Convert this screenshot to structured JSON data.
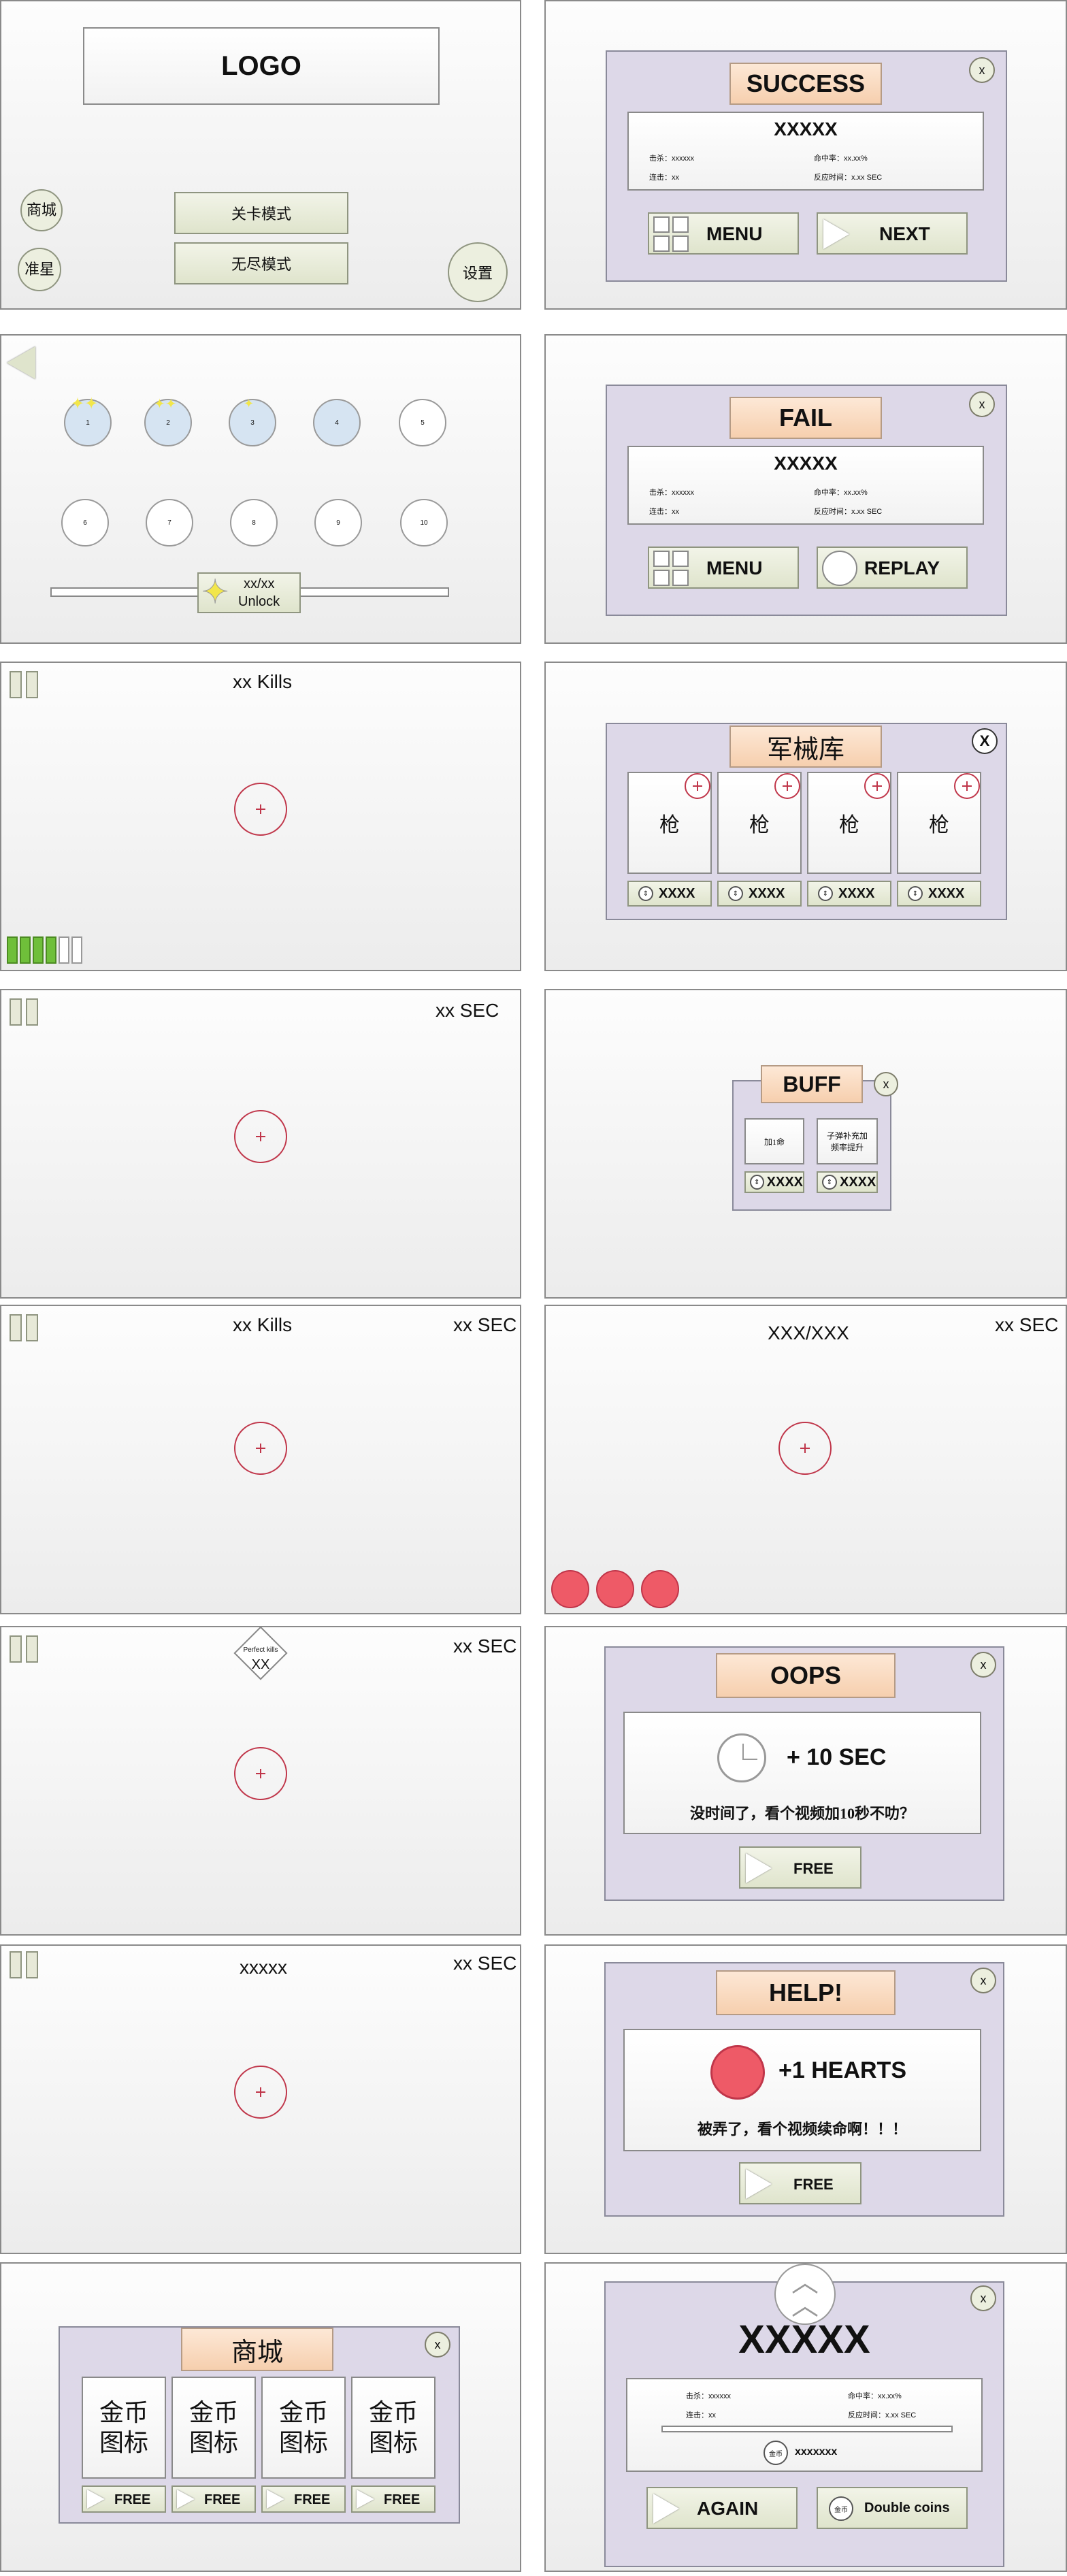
{
  "home": {
    "logo": "LOGO",
    "shop": "商城",
    "crosshair": "准星",
    "level_mode": "关卡模式",
    "endless_mode": "无尽模式",
    "settings": "设置"
  },
  "success": {
    "title": "SUCCESS",
    "name": "XXXXX",
    "kills": "击杀：xxxxxx",
    "hit_rate": "命中率：xx.xx%",
    "streak": "连击：xx",
    "reaction": "反应时间：x.xx SEC",
    "menu": "MENU",
    "next": "NEXT",
    "close": "x"
  },
  "levels": {
    "nodes": [
      "1",
      "2",
      "3",
      "4",
      "5",
      "6",
      "7",
      "8",
      "9",
      "10"
    ],
    "progress": "xx/xx",
    "unlock": "Unlock"
  },
  "fail": {
    "title": "FAIL",
    "name": "XXXXX",
    "kills": "击杀：xxxxxx",
    "hit_rate": "命中率：xx.xx%",
    "streak": "连击：xx",
    "reaction": "反应时间：x.xx SEC",
    "menu": "MENU",
    "replay": "REPLAY",
    "close": "x"
  },
  "game_kills": {
    "kills": "xx Kills"
  },
  "armory": {
    "title": "军械库",
    "items": [
      "枪",
      "枪",
      "枪",
      "枪"
    ],
    "prices": [
      "XXXX",
      "XXXX",
      "XXXX",
      "XXXX"
    ],
    "close": "X"
  },
  "game_sec": {
    "sec": "xx SEC"
  },
  "buff": {
    "title": "BUFF",
    "items": [
      "加1命",
      "子弹补充加\n频率提升"
    ],
    "prices": [
      "XXXX",
      "XXXX"
    ],
    "close": "x"
  },
  "game_kills_sec": {
    "kills": "xx Kills",
    "sec": "xx SEC"
  },
  "game_ratio": {
    "ratio": "XXX/XXX",
    "sec": "xx SEC"
  },
  "game_perfect": {
    "badge": "Perfect kills",
    "count": "XX",
    "sec": "xx SEC"
  },
  "oops": {
    "title": "OOPS",
    "bonus": "+ 10 SEC",
    "message": "没时间了，看个视频加10秒不叻？",
    "free": "FREE",
    "close": "x"
  },
  "game_x": {
    "label": "xxxxx",
    "sec": "xx SEC"
  },
  "help": {
    "title": "HELP!",
    "bonus": "+1 HEARTS",
    "message": "被弄了，看个视频续命啊！！！",
    "free": "FREE",
    "close": "x"
  },
  "shop": {
    "title": "商城",
    "items": [
      "金币\n图标",
      "金币\n图标",
      "金币\n图标",
      "金币\n图标"
    ],
    "free": "FREE",
    "close": "x"
  },
  "result": {
    "name": "XXXXX",
    "kills": "击杀：xxxxxx",
    "hit_rate": "命中率：xx.xx%",
    "streak": "连击：xx",
    "reaction": "反应时间：x.xx SEC",
    "coin": "金币",
    "coins": "xxxxxxx",
    "again": "AGAIN",
    "double": "Double coins",
    "close": "x"
  },
  "colors": {
    "panel": "#ddd8e8",
    "title": "#f8d9bf",
    "green_btn": "#e4e8d2",
    "red": "#c0364a",
    "heart": "#ee5a67",
    "energy": "#6fbf3a"
  }
}
